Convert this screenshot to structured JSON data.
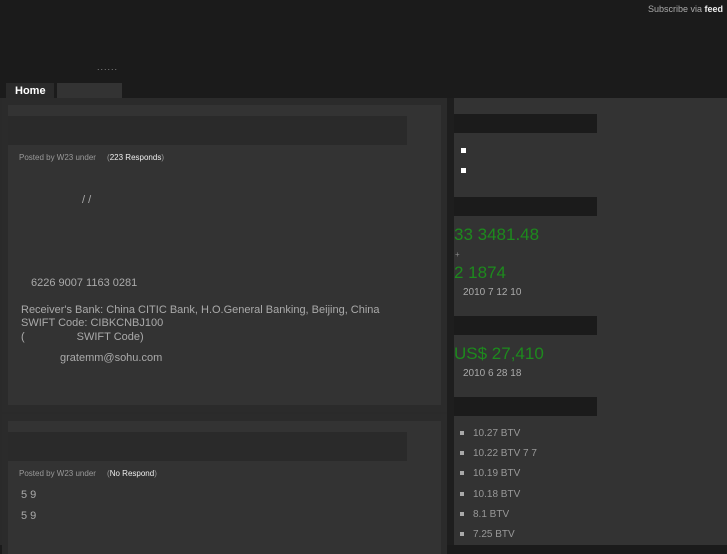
{
  "header": {
    "subscribe_prefix": "Subscribe via",
    "subscribe_link": "feed",
    "tagline": "......"
  },
  "nav": {
    "tabs": [
      {
        "label": "Home"
      },
      {
        "label": ""
      }
    ]
  },
  "posts": [
    {
      "meta_prefix": "Posted by W23 under",
      "responds": "223 Responds",
      "lines": {
        "slashes": "/          /",
        "account": "6226 9007 1163 0281",
        "bank": "Receiver's Bank: China CITIC Bank, H.O.General Banking, Beijing, China",
        "swift": "SWIFT Code: CIBKCNBJ100",
        "swift_note": "(                 SWIFT Code)",
        "email": "gratemm@sohu.com"
      }
    },
    {
      "meta_prefix": "Posted by W23 under",
      "responds": "No Respond",
      "lines": {
        "l1": "5 9",
        "l2": "5 9"
      }
    }
  ],
  "sidebar": {
    "stat1": {
      "value": "33 3481.48",
      "plus": "+",
      "value2": "2 1874",
      "date": "2010 7 12 10"
    },
    "stat2": {
      "value": "US$ 27,410",
      "date": "2010 6 28 18"
    },
    "news": [
      "10.27 BTV",
      "10.22 BTV 7 7",
      "10.19 BTV",
      "10.18 BTV",
      "8.1 BTV",
      "7.25 BTV"
    ]
  },
  "colors": {
    "accent_green": "#1d8a1d",
    "background": "#1b1b1b"
  }
}
